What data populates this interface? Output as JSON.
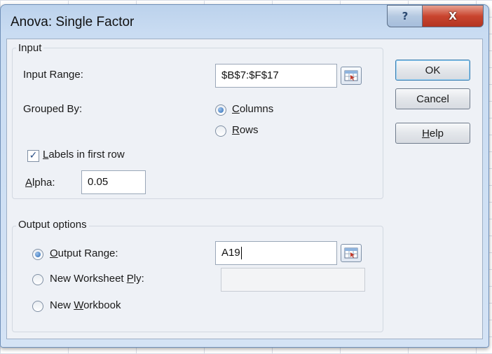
{
  "dialog": {
    "title": "Anova: Single Factor",
    "help_button": "?",
    "close_button": "X"
  },
  "input_group": {
    "label": "Input",
    "input_range_label": "Input Range:",
    "input_range_value": "$B$7:$F$17",
    "grouped_by_label": "Grouped By:",
    "columns_option": {
      "label_u": "C",
      "label_rest": "olumns",
      "selected": true
    },
    "rows_option": {
      "label_u": "R",
      "label_rest": "ows",
      "selected": false
    },
    "labels_checkbox": {
      "label_u": "L",
      "label_rest": "abels in first row",
      "checked": true,
      "mark": "✓"
    },
    "alpha_label_u": "A",
    "alpha_label_rest": "lpha:",
    "alpha_value": "0.05"
  },
  "output_group": {
    "label": "Output options",
    "output_range": {
      "label_u": "O",
      "label_rest": "utput Range:",
      "selected": true,
      "value": "A19"
    },
    "new_worksheet": {
      "label_pre": "New Worksheet ",
      "label_u": "P",
      "label_rest": "ly:",
      "selected": false,
      "value": ""
    },
    "new_workbook": {
      "label_pre": "New ",
      "label_u": "W",
      "label_rest": "orkbook",
      "selected": false
    }
  },
  "buttons": {
    "ok": "OK",
    "cancel": "Cancel",
    "help_u": "H",
    "help_rest": "elp"
  },
  "icons": {
    "range_picker": "range-select-icon"
  }
}
